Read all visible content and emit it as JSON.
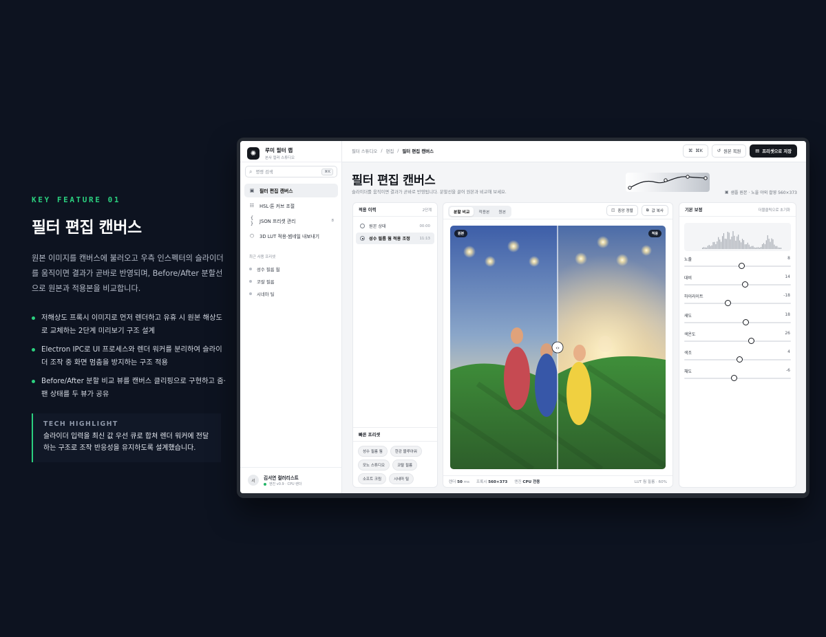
{
  "feature": {
    "kicker": "KEY FEATURE 01",
    "title": "필터 편집 캔버스",
    "description": "원본 이미지를 캔버스에 불러오고 우측 인스펙터의 슬라이더를 움직이면 결과가 곧바로 반영되며, Before/After 분할선으로 원본과 적용본을 비교합니다.",
    "bullets": [
      "저해상도 프록시 이미지로 먼저 렌더하고 유휴 시 원본 해상도로 교체하는 2단계 미리보기 구조 설계",
      "Electron IPC로 UI 프로세스와 렌더 워커를 분리하여 슬라이더 조작 중 화면 멈춤을 방지하는 구조 적용",
      "Before/After 분할 비교 뷰를 캔버스 클리핑으로 구현하고 줌·팬 상태를 두 뷰가 공유"
    ],
    "tech_label": "TECH HIGHLIGHT",
    "tech_text": "슬라이더 입력을 최신 값 우선 큐로 합쳐 렌더 워커에 전달하는 구조로 조작 반응성을 유지하도록 설계했습니다."
  },
  "app": {
    "brand": {
      "name": "루미 필터 랩",
      "sub": "본사 컬러 스튜디오"
    },
    "search": {
      "placeholder": "명령 검색",
      "shortcut": "⌘K"
    },
    "nav": [
      {
        "icon": "image-icon",
        "glyph": "▣",
        "label": "필터 편집 캔버스",
        "count": ""
      },
      {
        "icon": "sliders-icon",
        "glyph": "☷",
        "label": "HSL·톤 커브 조절",
        "count": ""
      },
      {
        "icon": "braces-icon",
        "glyph": "{ }",
        "label": "JSON 프리셋 관리",
        "count": "8"
      },
      {
        "icon": "cube-icon",
        "glyph": "⬡",
        "label": "3D LUT 적용·썸네일 내보내기",
        "count": ""
      }
    ],
    "recent_header": "최근 사용 프리셋",
    "recent": [
      "성수 필름 웜",
      "코랄 필름",
      "시네마 틸"
    ],
    "user": {
      "initial": "서",
      "name": "김서연 컬러리스트",
      "status": "엔진 v0.9 · CPU 렌더"
    },
    "breadcrumb": {
      "a": "필터 스튜디오",
      "b": "편집",
      "current": "필터 편집 캔버스",
      "sep": "/"
    },
    "toolbar": {
      "cmd_label": "⌘K",
      "restore_label": "원본 복원",
      "save_label": "프리셋으로 저장"
    },
    "page": {
      "title": "필터 편집 캔버스",
      "subtitle": "슬라이더를 움직이면 결과가 곧바로 반영됩니다. 분할선을 끌어 원본과 비교해 보세요.",
      "sample_meta": "샘플 원본 · 노을 야외 촬영 560×373"
    },
    "history": {
      "title": "적용 이력",
      "meta": "2단계",
      "items": [
        {
          "label": "원본 상태",
          "time": "00:00",
          "active": false
        },
        {
          "label": "성수 필름 웜 적용 조정",
          "time": "11:13",
          "active": true
        }
      ]
    },
    "quick": {
      "title": "빠른 프리셋",
      "chips": [
        "성수 필름 웜",
        "한강 블루아워",
        "모노 스튜디오",
        "코랄 필름",
        "소프트 크림",
        "시네마 틸"
      ]
    },
    "canvas": {
      "tabs": [
        "분할 비교",
        "적용본",
        "원본"
      ],
      "active_tab": 0,
      "center_label": "중앙 정렬",
      "copy_label": "값 복사",
      "before_tag": "원본",
      "after_tag": "적용",
      "split_fraction": 0.5,
      "footer": {
        "render_label": "렌더",
        "render_value": "50",
        "render_unit": "ms",
        "proxy_label": "프록시",
        "proxy_value": "560×373",
        "engine_label": "엔진",
        "engine_value": "CPU 전용",
        "lut": "LUT 웜 필름 · 60%"
      }
    },
    "inspector": {
      "title": "기본 보정",
      "reset_hint": "더블클릭으로 초기화",
      "sliders": [
        {
          "label": "노출",
          "value": "8",
          "position": 0.54
        },
        {
          "label": "대비",
          "value": "14",
          "position": 0.57
        },
        {
          "label": "하이라이트",
          "value": "-18",
          "position": 0.41
        },
        {
          "label": "섀도",
          "value": "18",
          "position": 0.58
        },
        {
          "label": "색온도",
          "value": "26",
          "position": 0.63
        },
        {
          "label": "색조",
          "value": "4",
          "position": 0.52
        },
        {
          "label": "채도",
          "value": "-6",
          "position": 0.47
        }
      ]
    }
  }
}
